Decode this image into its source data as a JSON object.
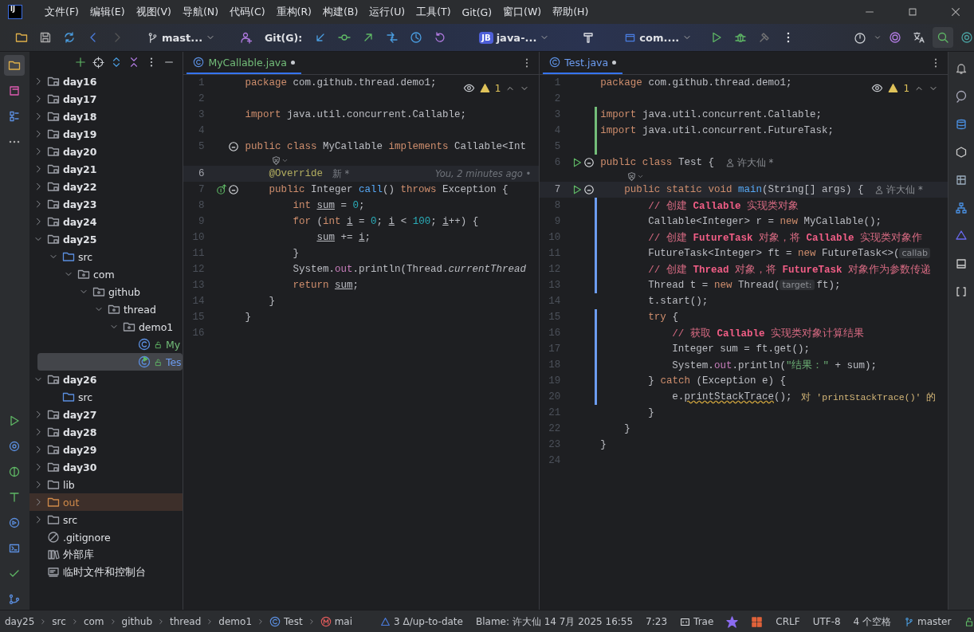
{
  "logo_text": "IJ",
  "menu": [
    "文件(F)",
    "编辑(E)",
    "视图(V)",
    "导航(N)",
    "代码(C)",
    "重构(R)",
    "构建(B)",
    "运行(U)",
    "工具(T)",
    "Git(G)",
    "窗口(W)",
    "帮助(H)"
  ],
  "toolbar": {
    "branch": "mast...",
    "git_label": "Git(G):",
    "project_badge": "JB",
    "project": "java-...",
    "run_config": "com...."
  },
  "left_tools": [
    {
      "kind": "project",
      "selected": true
    },
    {
      "kind": "commit",
      "selected": false
    },
    {
      "kind": "structure",
      "selected": false
    },
    {
      "kind": "more",
      "selected": false
    }
  ],
  "left_tools_bottom": [
    {
      "kind": "run"
    },
    {
      "kind": "services"
    },
    {
      "kind": "plugins"
    },
    {
      "kind": "build"
    },
    {
      "kind": "deploy"
    },
    {
      "kind": "terminal"
    },
    {
      "kind": "problems"
    },
    {
      "kind": "git"
    }
  ],
  "right_tools": [
    {
      "kind": "notifications"
    },
    {
      "kind": "ai-chat"
    },
    {
      "kind": "database"
    },
    {
      "kind": "plugin"
    },
    {
      "kind": "gradle"
    },
    {
      "kind": "hierarchy"
    },
    {
      "kind": "maven"
    },
    {
      "kind": "coverage"
    },
    {
      "kind": "bracket"
    }
  ],
  "project_tree": [
    {
      "label": "day16",
      "kind": "module",
      "expanded": false,
      "selected": false
    },
    {
      "label": "day17",
      "kind": "module",
      "expanded": false,
      "selected": false
    },
    {
      "label": "day18",
      "kind": "module",
      "expanded": false,
      "selected": false
    },
    {
      "label": "day19",
      "kind": "module",
      "expanded": false,
      "selected": false
    },
    {
      "label": "day20",
      "kind": "module",
      "expanded": false,
      "selected": false
    },
    {
      "label": "day21",
      "kind": "module",
      "expanded": false,
      "selected": false
    },
    {
      "label": "day22",
      "kind": "module",
      "expanded": false,
      "selected": false
    },
    {
      "label": "day23",
      "kind": "module",
      "expanded": false,
      "selected": false
    },
    {
      "label": "day24",
      "kind": "module",
      "expanded": false,
      "selected": false
    },
    {
      "label": "day25",
      "kind": "module",
      "expanded": true,
      "selected": false,
      "children": [
        {
          "label": "src",
          "kind": "src",
          "expanded": true,
          "selected": false,
          "children": [
            {
              "label": "com",
              "kind": "package",
              "expanded": true,
              "selected": false,
              "children": [
                {
                  "label": "github",
                  "kind": "package",
                  "expanded": true,
                  "selected": false,
                  "children": [
                    {
                      "label": "thread",
                      "kind": "package",
                      "expanded": true,
                      "selected": false,
                      "children": [
                        {
                          "label": "demo1",
                          "kind": "package",
                          "expanded": true,
                          "selected": false,
                          "children": [
                            {
                              "label": "My",
                              "kind": "class",
                              "color": "#73bd79",
                              "selected": false
                            },
                            {
                              "label": "Tes",
                              "kind": "runnable-class",
                              "color": "#6c9cf0",
                              "selected": true
                            }
                          ]
                        }
                      ]
                    }
                  ]
                }
              ]
            }
          ]
        }
      ]
    },
    {
      "label": "day26",
      "kind": "module",
      "expanded": true,
      "selected": false,
      "children": [
        {
          "label": "src",
          "kind": "src",
          "selected": false
        }
      ]
    },
    {
      "label": "day27",
      "kind": "module",
      "expanded": false,
      "selected": false
    },
    {
      "label": "day28",
      "kind": "module",
      "expanded": false,
      "selected": false
    },
    {
      "label": "day29",
      "kind": "module",
      "expanded": false,
      "selected": false
    },
    {
      "label": "day30",
      "kind": "module",
      "expanded": false,
      "selected": false
    },
    {
      "label": "lib",
      "kind": "folder",
      "expanded": false,
      "selected": false
    },
    {
      "label": "out",
      "kind": "excluded",
      "expanded": false,
      "selected": false
    },
    {
      "label": "src",
      "kind": "folder",
      "expanded": false,
      "selected": false
    },
    {
      "label": ".gitignore",
      "kind": "ignore-file",
      "selected": false
    },
    {
      "label": "外部库",
      "kind": "library",
      "selected": false
    },
    {
      "label": "临时文件和控制台",
      "kind": "scratch",
      "selected": false
    }
  ],
  "editors": [
    {
      "tab": {
        "label": "MyCallable.java",
        "color": "#73bd79",
        "modified": true,
        "selected": true
      },
      "warnings": "1",
      "lines": [
        {
          "kind": "code",
          "n": "1",
          "current": false,
          "code": [
            {
              "kind": "kw",
              "t": "package"
            },
            {
              "kind": "pl",
              "t": " com.github.thread.demo1;"
            }
          ]
        },
        {
          "kind": "code",
          "n": "2",
          "current": false
        },
        {
          "kind": "code",
          "n": "3",
          "current": false,
          "code": [
            {
              "kind": "kw",
              "t": "import"
            },
            {
              "kind": "pl",
              "t": " java.util.concurrent.Callable;"
            }
          ]
        },
        {
          "kind": "code",
          "n": "4",
          "current": false
        },
        {
          "kind": "code",
          "n": "5",
          "current": false,
          "gutter": [
            {
              "kind": "square"
            }
          ],
          "code": [
            {
              "kind": "kw",
              "t": "public class"
            },
            {
              "kind": "pl",
              "t": " MyCallable "
            },
            {
              "kind": "kw",
              "t": "implements"
            },
            {
              "kind": "pl",
              "t": " Callable<Int"
            }
          ]
        },
        {
          "kind": "vision"
        },
        {
          "kind": "code",
          "n": "6",
          "current": true,
          "code": [
            {
              "kind": "ann",
              "t": "    @Override"
            }
          ],
          "annotation": "新 *",
          "blame": "You, 2 minutes ago •"
        },
        {
          "kind": "code",
          "n": "7",
          "current": false,
          "gutter": [
            {
              "kind": "override"
            },
            {
              "kind": "square"
            }
          ],
          "code": [
            {
              "kind": "kw",
              "t": "    public"
            },
            {
              "kind": "pl",
              "t": " Integer "
            },
            {
              "kind": "decl",
              "t": "call"
            },
            {
              "kind": "pl",
              "t": "() "
            },
            {
              "kind": "kw",
              "t": "throws"
            },
            {
              "kind": "pl",
              "t": " Exception {"
            }
          ]
        },
        {
          "kind": "code",
          "n": "8",
          "current": false,
          "code": [
            {
              "kind": "kw",
              "t": "        int "
            },
            {
              "kind": "var",
              "t": "sum"
            },
            {
              "kind": "pl",
              "t": " = "
            },
            {
              "kind": "num",
              "t": "0"
            },
            {
              "kind": "pl",
              "t": ";"
            }
          ]
        },
        {
          "kind": "code",
          "n": "9",
          "current": false,
          "code": [
            {
              "kind": "kw",
              "t": "        for"
            },
            {
              "kind": "pl",
              "t": " ("
            },
            {
              "kind": "kw",
              "t": "int "
            },
            {
              "kind": "var",
              "t": "i"
            },
            {
              "kind": "pl",
              "t": " = "
            },
            {
              "kind": "num",
              "t": "0"
            },
            {
              "kind": "pl",
              "t": "; "
            },
            {
              "kind": "var",
              "t": "i"
            },
            {
              "kind": "pl",
              "t": " < "
            },
            {
              "kind": "num",
              "t": "100"
            },
            {
              "kind": "pl",
              "t": "; "
            },
            {
              "kind": "var",
              "t": "i"
            },
            {
              "kind": "pl",
              "t": "++) {"
            }
          ]
        },
        {
          "kind": "code",
          "n": "10",
          "current": false,
          "code": [
            {
              "kind": "var",
              "t": "            sum"
            },
            {
              "kind": "pl",
              "t": " += "
            },
            {
              "kind": "var",
              "t": "i"
            },
            {
              "kind": "pl",
              "t": ";"
            }
          ]
        },
        {
          "kind": "code",
          "n": "11",
          "current": false,
          "code": [
            {
              "kind": "pl",
              "t": "        }"
            }
          ]
        },
        {
          "kind": "code",
          "n": "12",
          "current": false,
          "code": [
            {
              "kind": "pl",
              "t": "        System."
            },
            {
              "kind": "field",
              "t": "out"
            },
            {
              "kind": "pl",
              "t": ".println(Thread."
            },
            {
              "kind": "it",
              "t": "currentThread"
            }
          ]
        },
        {
          "kind": "code",
          "n": "13",
          "current": false,
          "code": [
            {
              "kind": "kw",
              "t": "        return "
            },
            {
              "kind": "var",
              "t": "sum"
            },
            {
              "kind": "pl",
              "t": ";"
            }
          ]
        },
        {
          "kind": "code",
          "n": "14",
          "current": false,
          "code": [
            {
              "kind": "pl",
              "t": "    }"
            }
          ]
        },
        {
          "kind": "code",
          "n": "15",
          "current": false,
          "code": [
            {
              "kind": "pl",
              "t": "}"
            }
          ]
        },
        {
          "kind": "code",
          "n": "16",
          "current": false
        }
      ]
    },
    {
      "tab": {
        "label": "Test.java",
        "color": "#6c9cf0",
        "modified": true,
        "selected": true
      },
      "warnings": "1",
      "lines": [
        {
          "kind": "code",
          "n": "1",
          "current": false,
          "code": [
            {
              "kind": "kw",
              "t": "package"
            },
            {
              "kind": "pl",
              "t": " com.github.thread.demo1;"
            }
          ]
        },
        {
          "kind": "code",
          "n": "2",
          "current": false
        },
        {
          "kind": "code",
          "n": "3",
          "current": false,
          "change": {
            "kind": "added"
          },
          "code": [
            {
              "kind": "kw",
              "t": "import"
            },
            {
              "kind": "pl",
              "t": " java.util.concurrent.Callable;"
            }
          ]
        },
        {
          "kind": "code",
          "n": "4",
          "current": false,
          "change": {
            "kind": "added"
          },
          "code": [
            {
              "kind": "kw",
              "t": "import"
            },
            {
              "kind": "pl",
              "t": " java.util.concurrent.FutureTask;"
            }
          ]
        },
        {
          "kind": "code",
          "n": "5",
          "current": false,
          "change": {
            "kind": "added"
          }
        },
        {
          "kind": "code",
          "n": "6",
          "current": false,
          "gutter": [
            {
              "kind": "run"
            },
            {
              "kind": "square"
            }
          ],
          "code": [
            {
              "kind": "kw",
              "t": "public class"
            },
            {
              "kind": "pl",
              "t": " Test {"
            }
          ],
          "author": "许大仙 *"
        },
        {
          "kind": "vision"
        },
        {
          "kind": "code",
          "n": "7",
          "current": true,
          "gutter": [
            {
              "kind": "run"
            },
            {
              "kind": "square"
            }
          ],
          "code": [
            {
              "kind": "kw",
              "t": "    public static void "
            },
            {
              "kind": "decl",
              "t": "main"
            },
            {
              "kind": "pl",
              "t": "(String[] args) {"
            }
          ],
          "author": "许大仙 *"
        },
        {
          "kind": "code",
          "n": "8",
          "current": false,
          "change": {
            "kind": "modified"
          },
          "code": [
            {
              "kind": "cmt",
              "t": "        // 创建 "
            },
            {
              "kind": "cmtb",
              "t": "Callable"
            },
            {
              "kind": "cmt",
              "t": " 实现类对象"
            }
          ]
        },
        {
          "kind": "code",
          "n": "9",
          "current": false,
          "change": {
            "kind": "modified"
          },
          "code": [
            {
              "kind": "pl",
              "t": "        Callable<Integer> r = "
            },
            {
              "kind": "kw",
              "t": "new"
            },
            {
              "kind": "pl",
              "t": " MyCallable();"
            }
          ]
        },
        {
          "kind": "code",
          "n": "10",
          "current": false,
          "change": {
            "kind": "modified"
          },
          "code": [
            {
              "kind": "cmt",
              "t": "        // 创建 "
            },
            {
              "kind": "cmtb",
              "t": "FutureTask"
            },
            {
              "kind": "cmt",
              "t": " 对象，将 "
            },
            {
              "kind": "cmtb",
              "t": "Callable"
            },
            {
              "kind": "cmt",
              "t": " 实现类对象作"
            }
          ]
        },
        {
          "kind": "code",
          "n": "11",
          "current": false,
          "change": {
            "kind": "modified"
          },
          "code": [
            {
              "kind": "pl",
              "t": "        FutureTask<Integer> ft = "
            },
            {
              "kind": "kw",
              "t": "new"
            },
            {
              "kind": "pl",
              "t": " FutureTask<>("
            },
            {
              "kind": "hint",
              "t": "callab"
            }
          ]
        },
        {
          "kind": "code",
          "n": "12",
          "current": false,
          "change": {
            "kind": "modified"
          },
          "code": [
            {
              "kind": "cmt",
              "t": "        // 创建 "
            },
            {
              "kind": "cmtb",
              "t": "Thread"
            },
            {
              "kind": "cmt",
              "t": " 对象，将 "
            },
            {
              "kind": "cmtb",
              "t": "FutureTask"
            },
            {
              "kind": "cmt",
              "t": " 对象作为参数传递"
            }
          ]
        },
        {
          "kind": "code",
          "n": "13",
          "current": false,
          "change": {
            "kind": "modified"
          },
          "code": [
            {
              "kind": "pl",
              "t": "        Thread t = "
            },
            {
              "kind": "kw",
              "t": "new"
            },
            {
              "kind": "pl",
              "t": " Thread("
            },
            {
              "kind": "hint",
              "t": "target:"
            },
            {
              "kind": "pl",
              "t": "ft);"
            }
          ]
        },
        {
          "kind": "code",
          "n": "14",
          "current": false,
          "code": [
            {
              "kind": "pl",
              "t": "        t.start();"
            }
          ]
        },
        {
          "kind": "code",
          "n": "15",
          "current": false,
          "change": {
            "kind": "modified"
          },
          "code": [
            {
              "kind": "kw",
              "t": "        try"
            },
            {
              "kind": "pl",
              "t": " {"
            }
          ]
        },
        {
          "kind": "code",
          "n": "16",
          "current": false,
          "change": {
            "kind": "modified"
          },
          "code": [
            {
              "kind": "cmt",
              "t": "            // 获取 "
            },
            {
              "kind": "cmtb",
              "t": "Callable"
            },
            {
              "kind": "cmt",
              "t": " 实现类对象计算结果"
            }
          ]
        },
        {
          "kind": "code",
          "n": "17",
          "current": false,
          "change": {
            "kind": "modified"
          },
          "code": [
            {
              "kind": "pl",
              "t": "            Integer sum = ft.get();"
            }
          ]
        },
        {
          "kind": "code",
          "n": "18",
          "current": false,
          "change": {
            "kind": "modified"
          },
          "code": [
            {
              "kind": "pl",
              "t": "            System."
            },
            {
              "kind": "field",
              "t": "out"
            },
            {
              "kind": "pl",
              "t": ".println("
            },
            {
              "kind": "str",
              "t": "\"结果：\""
            },
            {
              "kind": "pl",
              "t": " + sum);"
            }
          ]
        },
        {
          "kind": "code",
          "n": "19",
          "current": false,
          "change": {
            "kind": "modified"
          },
          "code": [
            {
              "kind": "pl",
              "t": "        } "
            },
            {
              "kind": "kw",
              "t": "catch"
            },
            {
              "kind": "pl",
              "t": " (Exception e) {"
            }
          ]
        },
        {
          "kind": "code",
          "n": "20",
          "current": false,
          "change": {
            "kind": "modified"
          },
          "code": [
            {
              "kind": "pl",
              "t": "            e."
            },
            {
              "kind": "warn",
              "t": "printStackTrace"
            },
            {
              "kind": "pl",
              "t": "();"
            }
          ],
          "inline_hint": "对 'printStackTrace()' 的"
        },
        {
          "kind": "code",
          "n": "21",
          "current": false,
          "code": [
            {
              "kind": "pl",
              "t": "        }"
            }
          ]
        },
        {
          "kind": "code",
          "n": "22",
          "current": false,
          "code": [
            {
              "kind": "pl",
              "t": "    }"
            }
          ]
        },
        {
          "kind": "code",
          "n": "23",
          "current": false,
          "code": [
            {
              "kind": "pl",
              "t": "}"
            }
          ]
        },
        {
          "kind": "code",
          "n": "24",
          "current": false
        }
      ]
    }
  ],
  "status_bar": {
    "breadcrumbs": [
      {
        "label": "day25",
        "kind": "folder"
      },
      {
        "label": "src",
        "kind": "folder"
      },
      {
        "label": "com",
        "kind": "folder"
      },
      {
        "label": "github",
        "kind": "folder"
      },
      {
        "label": "thread",
        "kind": "folder"
      },
      {
        "label": "demo1",
        "kind": "folder"
      },
      {
        "label": "Test",
        "kind": "class"
      },
      {
        "label": "mai",
        "kind": "method"
      }
    ],
    "vcs_info": "3 Δ/up-to-date",
    "blame": "Blame: 许大仙 14 7月 2025 16:55",
    "position": "7:23",
    "plugin": "Trae",
    "line_separator": "CRLF",
    "encoding": "UTF-8",
    "indent": "4 个空格",
    "branch": "master"
  }
}
